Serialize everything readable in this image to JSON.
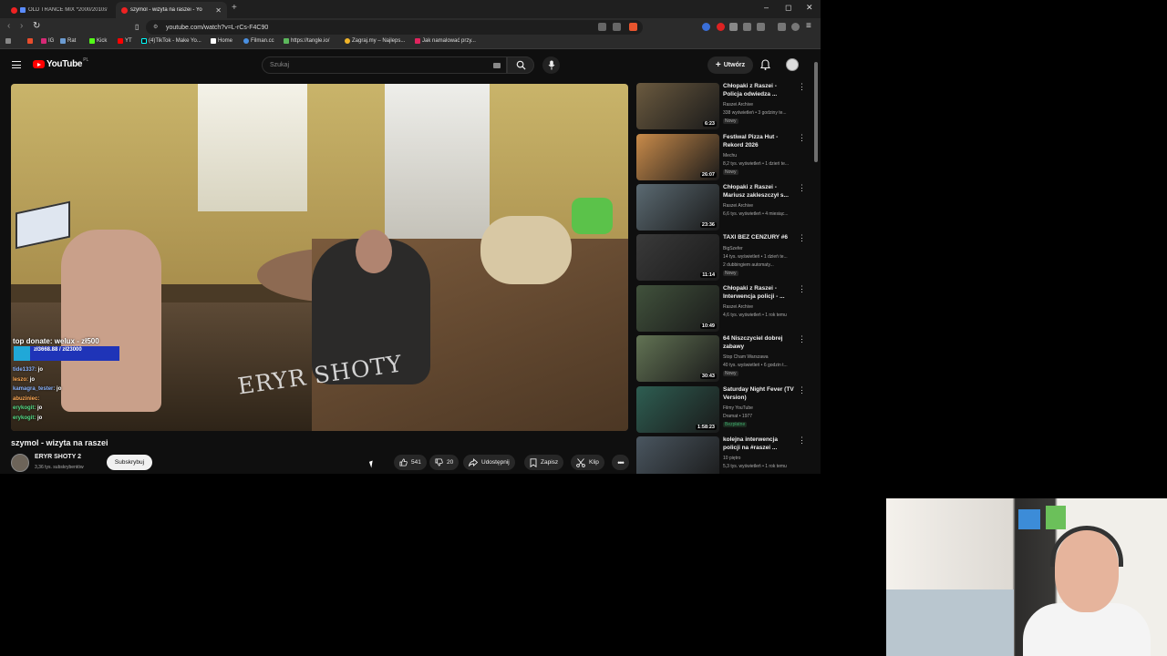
{
  "tabs": [
    {
      "title": "OLD TRANCE MIX *2000/2010s*"
    },
    {
      "title": "szymol - wizyta na raszei - Yo"
    }
  ],
  "address": {
    "url": "youtube.com/watch?v=L-rCs-F4C90"
  },
  "bookmarks": [
    "IG",
    "Rat",
    "Kick",
    "YT",
    "(4)TikTok - Make Yo...",
    "Home",
    "Filman.cc",
    "https://tangle.io/",
    "Zagraj.my – Najleps...",
    "Jak namalować przy..."
  ],
  "youtube": {
    "logo_text": "YouTube",
    "logo_country": "PL",
    "search_placeholder": "Szukaj",
    "create_label": "Utwórz"
  },
  "overlay": {
    "donate_title": "top donate: welux - zł500",
    "donate_amount": "zł3668.88 / zł23000",
    "watermark": "ERYR SHOTY",
    "chat": [
      {
        "user": "tide1337:",
        "msg": "jo"
      },
      {
        "user": "leszo:",
        "msg": "jo"
      },
      {
        "user": "kamagra_tester:",
        "msg": "jo"
      },
      {
        "user": "abuziniec:",
        "msg": ""
      },
      {
        "user": "erykogit:",
        "msg": "jo"
      },
      {
        "user": "erykogit:",
        "msg": "jo"
      }
    ]
  },
  "video": {
    "title": "szymol - wizyta na raszei",
    "channel": "ERYR SHOTY 2",
    "subscribers": "3,36 tys. subskrybentów",
    "subscribe_label": "Subskrybuj",
    "likes": "541",
    "dislikes": "20",
    "share_label": "Udostępnij",
    "save_label": "Zapisz",
    "clip_label": "Klip"
  },
  "recommendations": [
    {
      "title": "Chłopaki z Raszei - Policja odwiedza ...",
      "channel": "Raszei Archive",
      "meta": "338 wyświetleń • 3 godziny te...",
      "badge": "Nowy",
      "duration": "6:23",
      "thumb_color": "#6b5a3f"
    },
    {
      "title": "Festiwal Pizza Hut - Rekord 2026",
      "channel": "Mechu",
      "meta": "8,2 tys. wyświetleń • 1 dzień te...",
      "badge": "Nowy",
      "duration": "26:07",
      "thumb_color": "#c98b4a"
    },
    {
      "title": "Chłopaki z Raszei - Mariusz zakleszczył s...",
      "channel": "Raszei Archive",
      "meta": "6,6 tys. wyświetleń • 4 miesiąc...",
      "badge": "",
      "duration": "23:36",
      "thumb_color": "#5b6a72"
    },
    {
      "title": "TAXI BEZ CENZURY #6",
      "channel": "BigSzefer",
      "meta": "14 tys. wyświetleń • 1 dzień te...",
      "badge": "Nowy",
      "extra": "2 dubbingiem automaty...",
      "duration": "11:14",
      "thumb_color": "#3a3a3a"
    },
    {
      "title": "Chłopaki z Raszei - Interwencja policji - ...",
      "channel": "Raszei Archive",
      "meta": "4,6 tys. wyświetleń • 1 rok temu",
      "badge": "",
      "duration": "10:49",
      "thumb_color": "#41523c"
    },
    {
      "title": "64 Niszczyciel dobrej zabawy",
      "channel": "Stop Cham Warszawa",
      "meta": "40 tys. wyświetleń • 6 godzin t...",
      "badge": "Nowy",
      "duration": "30:43",
      "thumb_color": "#627354"
    },
    {
      "title": "Saturday Night Fever (TV Version)",
      "channel": "Filmy YouTube",
      "meta": "Dramat • 1977",
      "badge": "Bezpłatne",
      "duration": "1:58:23",
      "thumb_color": "#2e5e52"
    },
    {
      "title": "kolejna interwencja policji na #raszei ...",
      "channel": "10 piętro",
      "meta": "5,3 tys. wyświetleń • 1 rok temu",
      "badge": "",
      "duration": "",
      "thumb_color": "#4a5660"
    }
  ]
}
